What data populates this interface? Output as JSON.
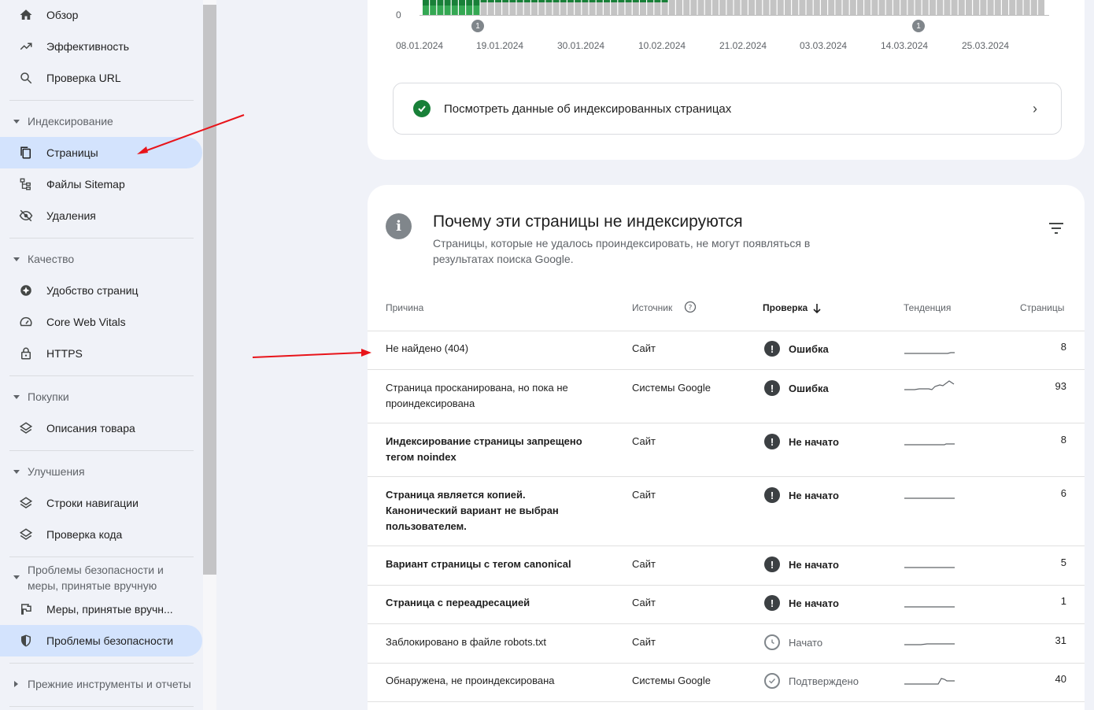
{
  "sidebar": {
    "items_top": [
      {
        "label": "Обзор",
        "icon": "home-icon"
      },
      {
        "label": "Эффективность",
        "icon": "trending-up-icon"
      },
      {
        "label": "Проверка URL",
        "icon": "search-icon"
      }
    ],
    "section_indexing": "Индексирование",
    "items_indexing": [
      {
        "label": "Страницы",
        "icon": "pages-icon"
      },
      {
        "label": "Файлы Sitemap",
        "icon": "sitemap-icon"
      },
      {
        "label": "Удаления",
        "icon": "removals-icon"
      }
    ],
    "section_quality": "Качество",
    "items_quality": [
      {
        "label": "Удобство страниц",
        "icon": "page-experience-icon"
      },
      {
        "label": "Core Web Vitals",
        "icon": "speedometer-icon"
      },
      {
        "label": "HTTPS",
        "icon": "lock-icon"
      }
    ],
    "section_shopping": "Покупки",
    "items_shopping": [
      {
        "label": "Описания товара",
        "icon": "layers-icon"
      }
    ],
    "section_enhancements": "Улучшения",
    "items_enhancements": [
      {
        "label": "Строки навигации",
        "icon": "layers-icon"
      },
      {
        "label": "Проверка кода",
        "icon": "layers-icon"
      }
    ],
    "section_security": "Проблемы безопасности и меры, принятые вручную",
    "items_security": [
      {
        "label": "Меры, принятые вручн...",
        "icon": "flag-icon"
      },
      {
        "label": "Проблемы безопасности",
        "icon": "shield-icon"
      }
    ],
    "section_legacy": "Прежние инструменты и отчеты"
  },
  "chart": {
    "y_zero": "0",
    "x_ticks": [
      "08.01.2024",
      "19.01.2024",
      "30.01.2024",
      "10.02.2024",
      "21.02.2024",
      "03.03.2024",
      "14.03.2024",
      "25.03.2024"
    ],
    "markers": [
      "1",
      "1"
    ]
  },
  "indexed_link": {
    "label": "Посмотреть данные об индексированных страницах"
  },
  "not_indexed": {
    "title": "Почему эти страницы не индексируются",
    "subtitle": "Страницы, которые не удалось проиндексировать, не могут появляться в результатах поиска Google.",
    "columns": {
      "reason": "Причина",
      "source": "Источник",
      "validation": "Проверка",
      "trend": "Тенденция",
      "pages": "Страницы"
    },
    "rows": [
      {
        "reason": "Не найдено (404)",
        "source": "Сайт",
        "status": "Ошибка",
        "pages": "8"
      },
      {
        "reason": "Страница просканирована, но пока не проиндексирована",
        "source": "Системы Google",
        "status": "Ошибка",
        "pages": "93"
      },
      {
        "reason": "Индексирование страницы запрещено тегом noindex",
        "source": "Сайт",
        "status": "Не начато",
        "pages": "8"
      },
      {
        "reason": "Страница является копией. Канонический вариант не выбран пользователем.",
        "source": "Сайт",
        "status": "Не начато",
        "pages": "6"
      },
      {
        "reason": "Вариант страницы с тегом canonical",
        "source": "Сайт",
        "status": "Не начато",
        "pages": "5"
      },
      {
        "reason": "Страница с переадресацией",
        "source": "Сайт",
        "status": "Не начато",
        "pages": "1"
      },
      {
        "reason": "Заблокировано в файле robots.txt",
        "source": "Сайт",
        "status": "Начато",
        "pages": "31"
      },
      {
        "reason": "Обнаружена, не проиндексирована",
        "source": "Системы Google",
        "status": "Подтверждено",
        "pages": "40"
      }
    ]
  },
  "colors": {
    "accent": "#d3e3fd",
    "annotation_arrow": "#e8141a",
    "bar_green": "#188038",
    "bar_gray": "#c4c4c4"
  }
}
